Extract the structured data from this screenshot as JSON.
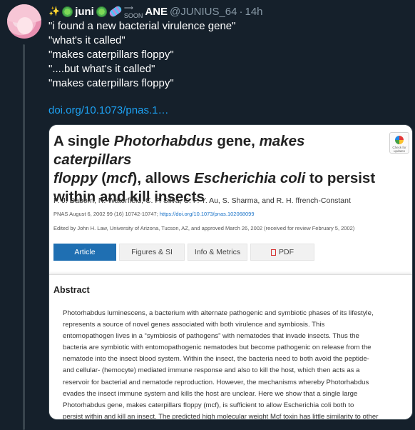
{
  "tweet": {
    "display_name_left": "juni",
    "display_name_right": "ANE",
    "soon_text": "SOON",
    "handle": "@JUNIUS_64",
    "separator": "·",
    "time": "14h",
    "lines": [
      "\"i found a new bacterial virulence gene\"",
      "\"what's it called\"",
      "\"makes caterpillars floppy\"",
      "\"....but what's it called\"",
      "\"makes caterpillars floppy\""
    ],
    "link_text": "doi.org/10.1073/pnas.1…"
  },
  "paper": {
    "title_lines": [
      "A single Photorhabdus gene, makes caterpillars",
      "floppy (mcf), allows Escherichia coli to persist",
      "within and kill insects"
    ],
    "check_badge_text": "Check for updates",
    "authors": "P. J. Daborn, N. Waterfield, C. P. Silva, C. P. Y. Au, S. Sharma, and R. H. ffrench-Constant",
    "pnas_citation": "PNAS August 6, 2002 99 (16) 10742-10747;",
    "doi_link": "https://doi.org/10.1073/pnas.102068099",
    "edited_by": "Edited by John H. Law, University of Arizona, Tucson, AZ, and approved March 26, 2002 (received for review February 5, 2002)",
    "tabs": [
      "Article",
      "Figures & SI",
      "Info & Metrics",
      "PDF"
    ],
    "abstract_heading": "Abstract",
    "abstract_lines": [
      "Photorhabdus luminescens, a bacterium with alternate pathogenic and symbiotic phases of its lifestyle,",
      "represents a source of novel genes associated with both virulence and symbiosis. This",
      "entomopathogen lives in a “symbiosis of pathogens” with nematodes that invade insects. Thus the",
      "bacteria are symbiotic with entomopathogenic nematodes but become pathogenic on release from the",
      "nematode into the insect blood system. Within the insect, the bacteria need to both avoid the peptide-",
      "and cellular- (hemocyte) mediated immune response and also to kill the host, which then acts as a",
      "reservoir for bacterial and nematode reproduction. However, the mechanisms whereby Photorhabdus",
      "evades the insect immune system and kills the host are unclear. Here we show that a single large",
      "Photorhabdus gene, makes caterpillars floppy (mcf), is sufficient to allow Escherichia coli both to",
      "persist within and kill an insect. The predicted high molecular weight Mcf toxin has little similarity to other"
    ]
  },
  "colors": {
    "background": "#15202b",
    "link": "#1da1f2",
    "muted": "#8899a6",
    "active_tab": "#1f6fb2"
  },
  "icons": [
    "sparkles-emoji",
    "microbe-emoji",
    "dna-emoji",
    "soon-arrow-emoji",
    "pdf-icon",
    "check-for-updates-icon"
  ]
}
